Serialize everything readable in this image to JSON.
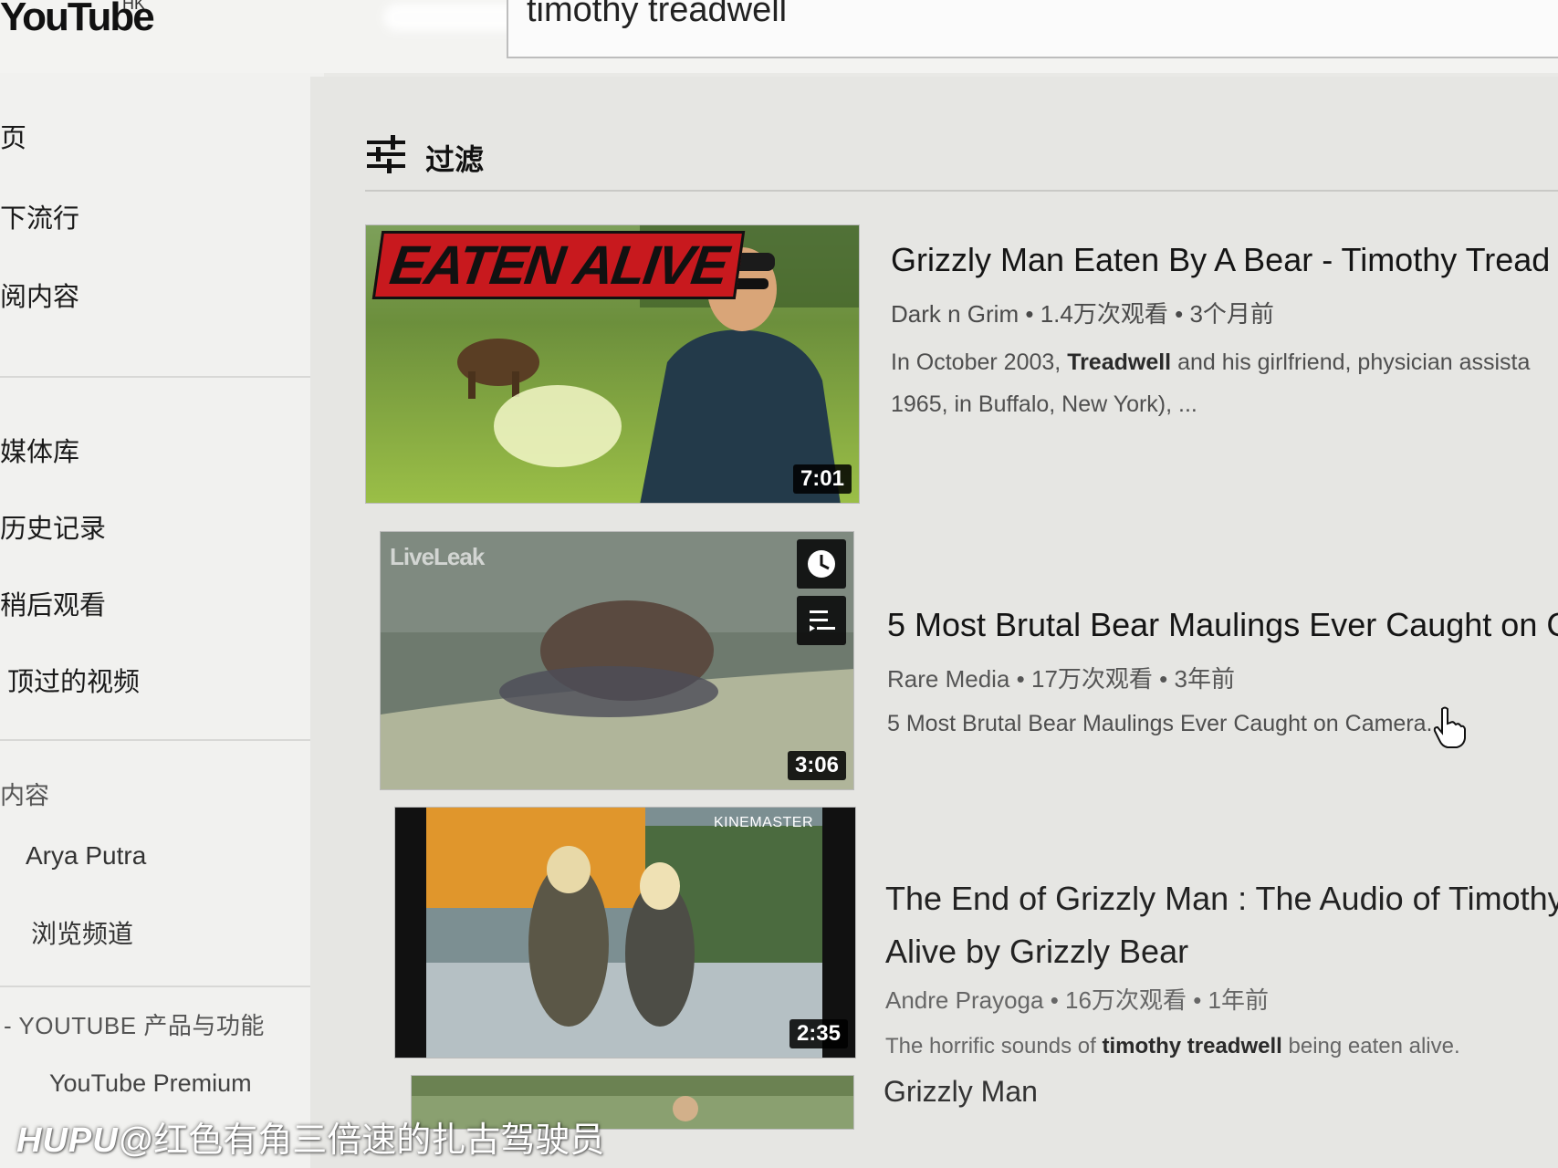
{
  "header": {
    "logo": "YouTube",
    "region": "HK",
    "search_query": "timothy treadwell"
  },
  "sidebar": {
    "items": [
      {
        "label": "页"
      },
      {
        "label": "下流行"
      },
      {
        "label": "阅内容"
      },
      {
        "label": "媒体库"
      },
      {
        "label": "历史记录"
      },
      {
        "label": "稍后观看"
      },
      {
        "label": "顶过的视频"
      }
    ],
    "subscriptions_heading": "内容",
    "subscriptions": [
      {
        "label": "Arya Putra"
      },
      {
        "label": "浏览频道"
      }
    ],
    "more_heading": "YOUTUBE 产品与功能",
    "more_items": [
      {
        "label": "YouTube Premium"
      }
    ]
  },
  "filter": {
    "label": "过滤"
  },
  "results": [
    {
      "title": "Grizzly Man Eaten By A Bear - Timothy Tread",
      "channel": "Dark n Grim",
      "views": "1.4万次观看",
      "age": "3个月前",
      "desc_pre": "In October 2003, ",
      "desc_bold": "Treadwell",
      "desc_post": " and his girlfriend, physician assista",
      "desc_line2": "1965, in Buffalo, New York), ...",
      "duration": "7:01",
      "thumb_overlay": "EATEN ALIVE"
    },
    {
      "title": "5 Most Brutal Bear Maulings Ever Caught on C",
      "channel": "Rare Media",
      "views": "17万次观看",
      "age": "3年前",
      "desc": "5 Most Brutal Bear Maulings Ever Caught on Camera.",
      "duration": "3:06",
      "thumb_overlay": "LiveLeak"
    },
    {
      "title_line1": "The End of Grizzly Man : The Audio of Timothy T",
      "title_line2": "Alive by Grizzly Bear",
      "channel": "Andre Prayoga",
      "views": "16万次观看",
      "age": "1年前",
      "desc_pre": "The horrific sounds of ",
      "desc_bold": "timothy treadwell",
      "desc_post": " being eaten alive.",
      "duration": "2:35",
      "thumb_overlay": "KINEMASTER"
    },
    {
      "title": "Grizzly Man"
    }
  ],
  "meta_separator": "•",
  "watermark": {
    "brand": "HUPU",
    "handle": "@红色有角三倍速的扎古驾驶员"
  },
  "colors": {
    "page_bg": "#e6e6e3",
    "sidebar_bg": "#f1f1ef",
    "duration_bg": "#000000",
    "eaten_alive_red": "#c8191e"
  }
}
